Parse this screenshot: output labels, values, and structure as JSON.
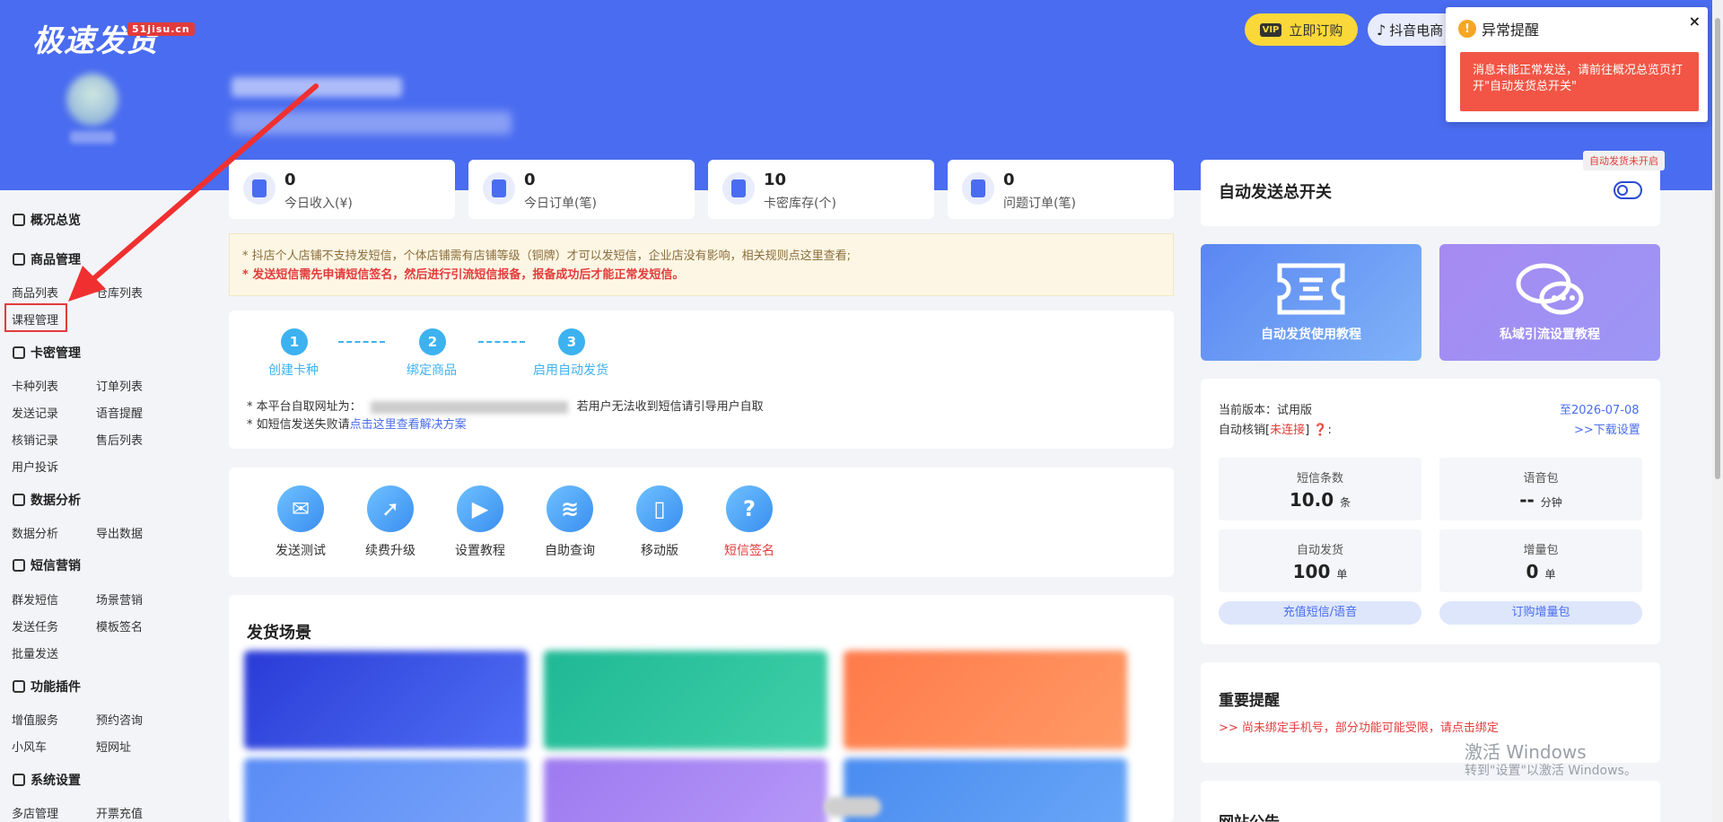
{
  "header": {
    "logo": "极速发货",
    "logo_badge": "51jisu.cn",
    "vip_tag": "VIP",
    "vip_button": "立即订购",
    "douyin_button": "抖音电商"
  },
  "notification": {
    "title": "异常提醒",
    "close": "×",
    "message": "消息未能正常发送，请前往概况总览页打开\"自动发货总开关\""
  },
  "sidebar": {
    "overview": "概况总览",
    "product_mgmt": "商品管理",
    "product_list": "商品列表",
    "warehouse_list": "仓库列表",
    "course_mgmt": "课程管理",
    "card_mgmt": "卡密管理",
    "card_type_list": "卡种列表",
    "order_list": "订单列表",
    "send_records": "发送记录",
    "voice_reminder": "语音提醒",
    "verify_records": "核销记录",
    "after_sales": "售后列表",
    "complaints": "用户投诉",
    "data_analysis_sec": "数据分析",
    "data_analysis": "数据分析",
    "export_data": "导出数据",
    "sms_marketing": "短信营销",
    "bulk_sms": "群发短信",
    "scene_marketing": "场景营销",
    "send_tasks": "发送任务",
    "template_sign": "模板签名",
    "batch_send": "批量发送",
    "plugins": "功能插件",
    "value_added": "增值服务",
    "reservation": "预约咨询",
    "small_windmill": "小风车",
    "short_url": "短网址",
    "system_settings": "系统设置",
    "multi_store": "多店管理",
    "recharge": "开票充值"
  },
  "stats": [
    {
      "value": "0",
      "label": "今日收入(¥)"
    },
    {
      "value": "0",
      "label": "今日订单(笔)"
    },
    {
      "value": "10",
      "label": "卡密库存(个)"
    },
    {
      "value": "0",
      "label": "问题订单(笔)"
    }
  ],
  "notice": {
    "line1": "* 抖店个人店铺不支持发短信，个体店铺需有店铺等级（铜牌）才可以发短信，企业店没有影响，相关规则点这里查看;",
    "line2": "* 发送短信需先申请短信签名，然后进行引流短信报备，报备成功后才能正常发短信。"
  },
  "steps": [
    {
      "num": "1",
      "label": "创建卡种"
    },
    {
      "num": "2",
      "label": "绑定商品"
    },
    {
      "num": "3",
      "label": "启用自动发货"
    }
  ],
  "address": {
    "prefix": "* 本平台自取网址为：",
    "suffix": "若用户无法收到短信请引导用户自取"
  },
  "fail": {
    "prefix": "* 如短信发送失败请",
    "link": "点击这里查看解决方案"
  },
  "tools": [
    {
      "label": "发送测试",
      "icon": "mail-icon"
    },
    {
      "label": "续费升级",
      "icon": "rocket-icon"
    },
    {
      "label": "设置教程",
      "icon": "play-icon"
    },
    {
      "label": "自助查询",
      "icon": "layers-icon"
    },
    {
      "label": "移动版",
      "icon": "phone-icon"
    },
    {
      "label": "短信签名",
      "icon": "question-icon"
    }
  ],
  "scene": {
    "title": "发货场景"
  },
  "switch": {
    "title": "自动发送总开关",
    "tooltip": "自动发货未开启"
  },
  "tutorials": {
    "auto": "自动发货使用教程",
    "private": "私域引流设置教程"
  },
  "info": {
    "version_label": "当前版本：试用版",
    "expiry": "至2026-07-08",
    "verify_prefix": "自动核销[",
    "verify_status": "未连接",
    "verify_suffix": "] ❓:",
    "download": ">>下载设置",
    "sms_title": "短信条数",
    "sms_value": "10.0",
    "sms_unit": "条",
    "voice_title": "语音包",
    "voice_value": "--",
    "voice_unit": "分钟",
    "auto_title": "自动发货",
    "auto_value": "100",
    "auto_unit": "单",
    "inc_title": "增量包",
    "inc_value": "0",
    "inc_unit": "单",
    "recharge_btn": "充值短信/语音",
    "inc_btn": "订购增量包"
  },
  "remind": {
    "title": "重要提醒",
    "text": ">> 尚未绑定手机号，部分功能可能受限，请点击绑定"
  },
  "site": {
    "title": "网站公告"
  },
  "windows": {
    "line1": "激活 Windows",
    "line2": "转到\"设置\"以激活 Windows。"
  },
  "colors": {
    "brand": "#4a6cf0",
    "alert": "#f25545",
    "accent": "#3db2f0"
  }
}
